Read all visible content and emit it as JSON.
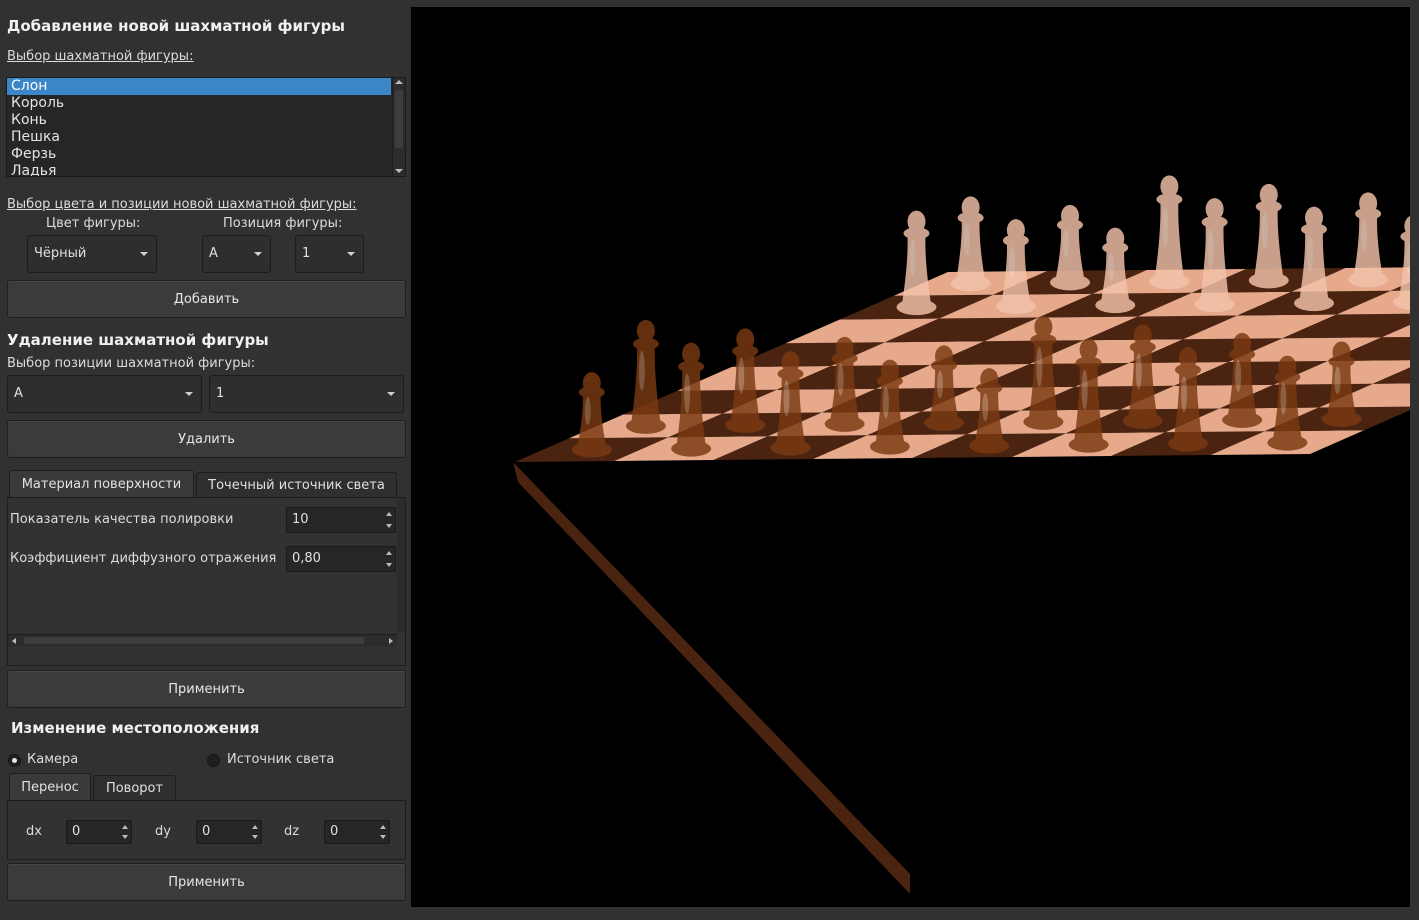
{
  "add_section": {
    "title": "Добавление новой шахматной фигуры",
    "piece_select_label": "Выбор шахматной фигуры:",
    "pieces": [
      "Слон",
      "Король",
      "Конь",
      "Пешка",
      "Ферзь",
      "Ладья"
    ],
    "selected_piece": "Слон",
    "color_pos_label": "Выбор цвета и позиции новой шахматной фигуры:",
    "color_label": "Цвет фигуры:",
    "position_label": "Позиция фигуры:",
    "color_value": "Чёрный",
    "col_value": "A",
    "row_value": "1",
    "add_button": "Добавить"
  },
  "delete_section": {
    "title": "Удаление шахматной фигуры",
    "position_label": "Выбор позиции шахматной фигуры:",
    "col_value": "A",
    "row_value": "1",
    "delete_button": "Удалить"
  },
  "material_section": {
    "tabs": [
      "Материал поверхности",
      "Точечный источник света"
    ],
    "active_tab": "Материал поверхности",
    "polish_label": "Показатель качества полировки",
    "polish_value": "10",
    "diffuse_label": "Коэффициент диффузного отражения",
    "diffuse_value": "0,80",
    "apply_button": "Применить"
  },
  "location_section": {
    "title": "Изменение местоположения",
    "radio_camera": "Камера",
    "radio_light": "Источник света",
    "selected_radio": "Камера",
    "tabs": [
      "Перенос",
      "Поворот"
    ],
    "active_tab": "Перенос",
    "dx_label": "dx",
    "dx_value": "0",
    "dy_label": "dy",
    "dy_value": "0",
    "dz_label": "dz",
    "dz_value": "0",
    "apply_button": "Применить"
  },
  "viewport": {
    "background": "#000000",
    "light_square": "#e6a98c",
    "dark_square": "#4a2410",
    "light_piece": "#f3c3aa",
    "dark_piece": "#7a3a12"
  }
}
